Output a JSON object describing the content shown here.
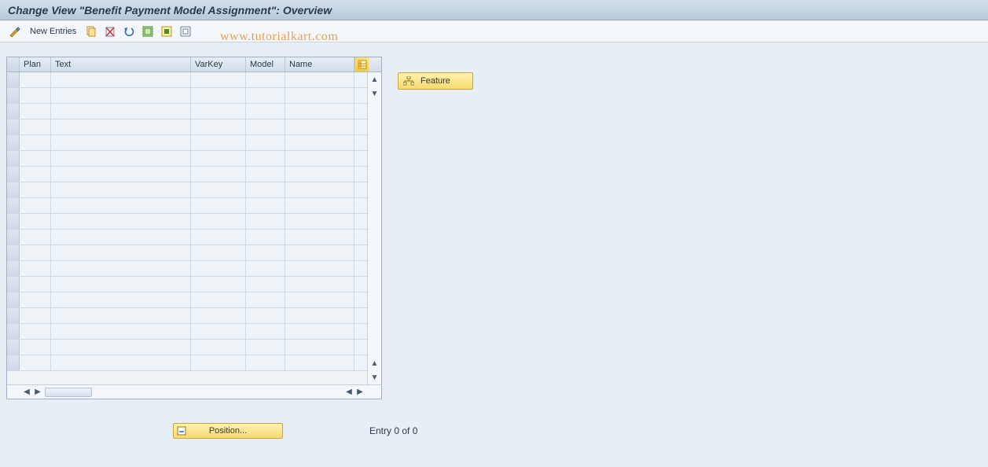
{
  "title": "Change View \"Benefit Payment Model Assignment\": Overview",
  "toolbar": {
    "new_entries_label": "New Entries"
  },
  "watermark": "www.tutorialkart.com",
  "grid": {
    "columns": {
      "plan": "Plan",
      "text": "Text",
      "varkey": "VarKey",
      "model": "Model",
      "name": "Name"
    },
    "row_count": 19
  },
  "feature_button_label": "Feature",
  "position_button_label": "Position...",
  "entry_status": "Entry 0 of 0"
}
